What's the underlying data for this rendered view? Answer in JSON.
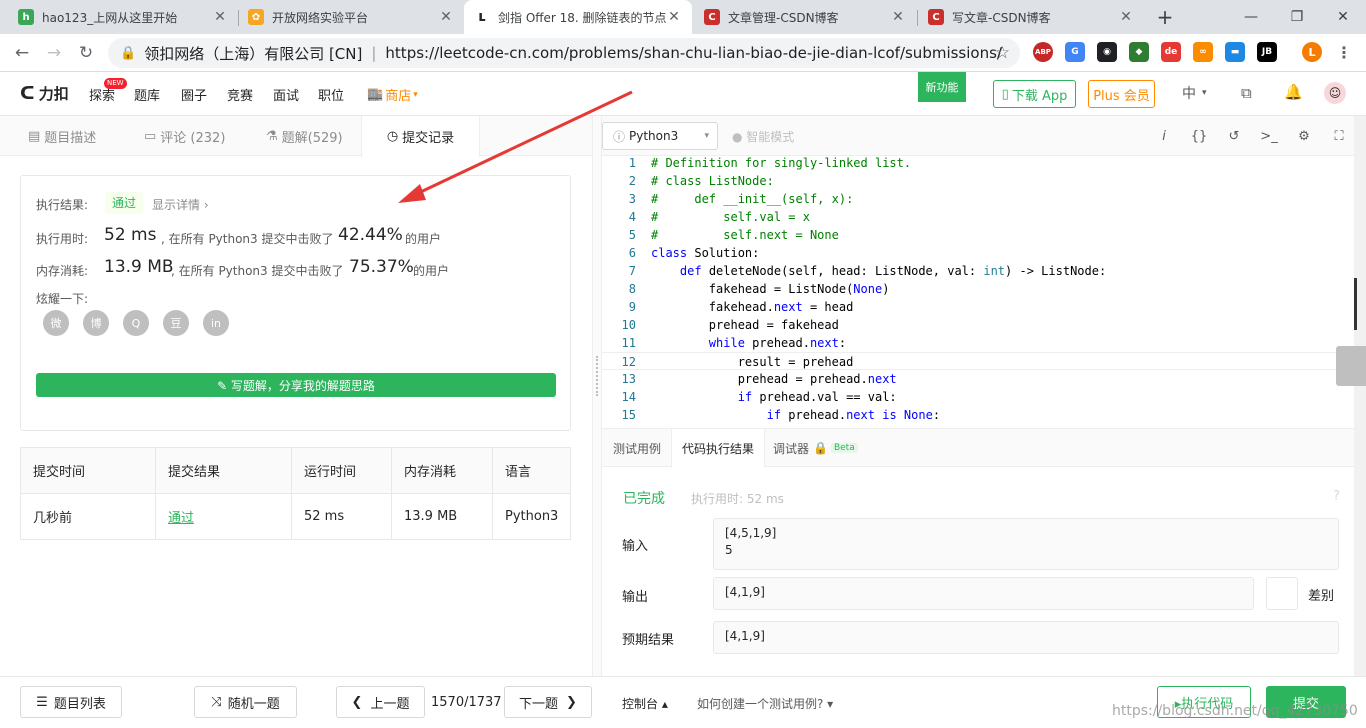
{
  "browser": {
    "tabs": [
      {
        "title": "hao123_上网从这里开始",
        "fav_color": "#3aa757",
        "fav_glyph": "h"
      },
      {
        "title": "开放网络实验平台",
        "fav_color": "#f5a623",
        "fav_glyph": "✿"
      },
      {
        "title": "剑指 Offer 18. 删除链表的节点",
        "fav_color": "#262626",
        "fav_glyph": "ʟ"
      },
      {
        "title": "文章管理-CSDN博客",
        "fav_color": "#c9302c",
        "fav_glyph": "C"
      },
      {
        "title": "写文章-CSDN博客",
        "fav_color": "#c9302c",
        "fav_glyph": "C"
      }
    ],
    "new_tab": "+",
    "cert_owner": "领扣网络（上海）有限公司 [CN]",
    "url": "https://leetcode-cn.com/problems/shan-chu-lian-biao-de-jie-dian-lcof/submissions/",
    "extensions": [
      {
        "label": "ABP",
        "color": "#c62828"
      },
      {
        "label": "G",
        "color": "#4285f4"
      },
      {
        "label": "◉",
        "color": "#202124"
      },
      {
        "label": "◆",
        "color": "#2e7d32"
      },
      {
        "label": "de",
        "color": "#e53935"
      },
      {
        "label": "∞",
        "color": "#fb8c00"
      },
      {
        "label": "▬",
        "color": "#1e88e5"
      },
      {
        "label": "JB",
        "color": "#000000"
      }
    ],
    "profile_initial": "L"
  },
  "site": {
    "logo": "力扣",
    "nav": [
      "探索",
      "题库",
      "圈子",
      "竞赛",
      "面试",
      "职位"
    ],
    "new_badge": "NEW",
    "store": "商店",
    "new_feature": "新功能",
    "download_app": "下载 App",
    "plus": "Plus 会员",
    "lang": "中"
  },
  "left": {
    "tabs": [
      "题目描述",
      "评论 (232)",
      "题解(529)",
      "提交记录"
    ],
    "result": {
      "status_label": "执行结果:",
      "status": "通过",
      "details": "显示详情 ›",
      "time_label": "执行用时:",
      "time_value": "52 ms",
      "time_mid": ", 在所有 Python3 提交中击败了",
      "time_pct": "42.44%",
      "time_tail": "的用户",
      "mem_label": "内存消耗:",
      "mem_value": "13.9 MB",
      "mem_mid": ", 在所有 Python3 提交中击败了",
      "mem_pct": "75.37%",
      "mem_tail": "的用户",
      "share_label": "炫耀一下:",
      "share_icons": [
        "微",
        "博",
        "Q",
        "豆",
        "in"
      ],
      "write_btn": "✎ 写题解，分享我的解题思路"
    },
    "table": {
      "headers": [
        "提交时间",
        "提交结果",
        "运行时间",
        "内存消耗",
        "语言"
      ],
      "row": [
        "几秒前",
        "通过",
        "52 ms",
        "13.9 MB",
        "Python3"
      ]
    }
  },
  "editor": {
    "language": "Python3",
    "smart_mode": "智能模式",
    "toolbar_icons": [
      "i",
      "{}",
      "↺",
      ">_",
      "⚙",
      "⛶"
    ]
  },
  "bottom": {
    "tabs": [
      "测试用例",
      "代码执行结果",
      "调试器",
      "Beta"
    ],
    "done": "已完成",
    "exec_time": "执行用时: 52 ms",
    "input_label": "输入",
    "input_line1": "[4,5,1,9]",
    "input_line2": "5",
    "output_label": "输出",
    "output_value": "[4,1,9]",
    "diff": "差别",
    "expected_label": "预期结果",
    "expected_value": "[4,1,9]"
  },
  "footer": {
    "list": "题目列表",
    "random": "随机一题",
    "prev": "上一题",
    "counter": "1570/1737",
    "next": "下一题",
    "console": "控制台 ▴",
    "howto": "如何创建一个测试用例? ▾",
    "run": "▸执行代码",
    "submit": "提交",
    "watermark": "https://blog.csdn.net/qq_42730750"
  },
  "colors": {
    "accent_green": "#2db55d",
    "link_green": "#3aa757",
    "store_orange": "#ff8a00"
  }
}
